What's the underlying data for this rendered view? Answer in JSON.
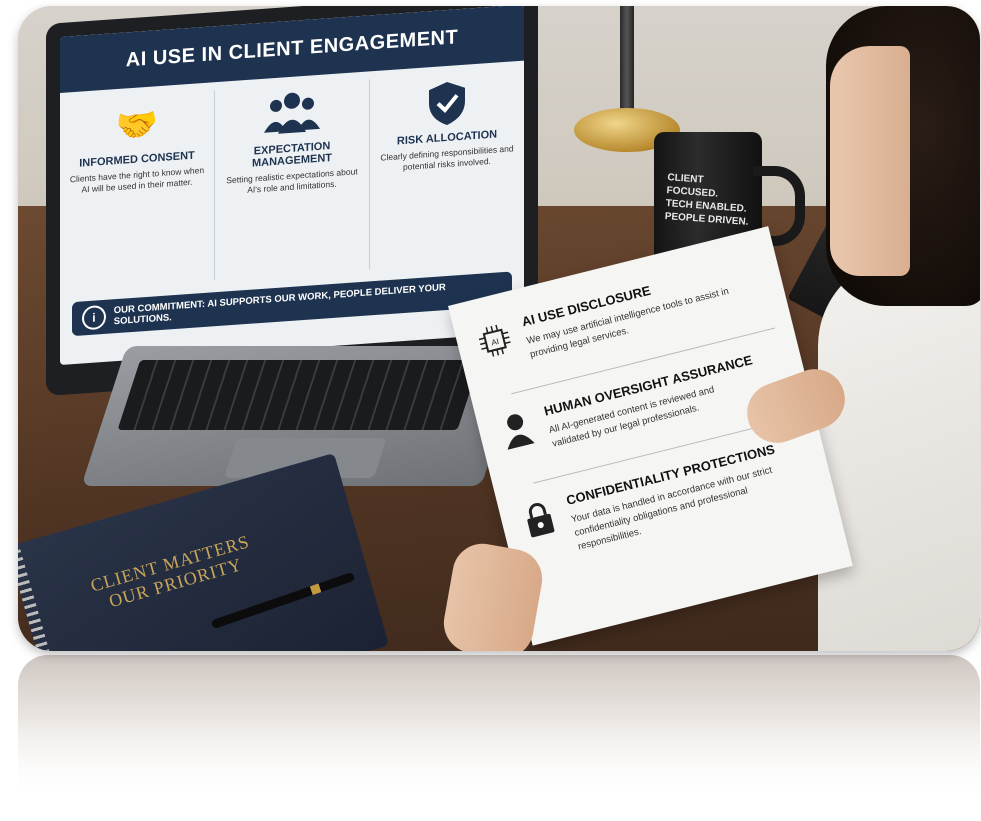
{
  "laptop_screen": {
    "title": "AI USE IN CLIENT ENGAGEMENT",
    "columns": [
      {
        "icon": "handshake-icon",
        "heading": "INFORMED CONSENT",
        "text": "Clients have the right to know when AI will be used in their matter."
      },
      {
        "icon": "people-group-icon",
        "heading": "EXPECTATION MANAGEMENT",
        "text": "Setting realistic expectations about AI's role and limitations."
      },
      {
        "icon": "shield-check-icon",
        "heading": "RISK ALLOCATION",
        "text": "Clearly defining responsibilities and potential risks involved."
      }
    ],
    "commitment": "OUR COMMITMENT: AI SUPPORTS OUR WORK, PEOPLE DELIVER YOUR SOLUTIONS."
  },
  "mug": {
    "line1": "CLIENT",
    "line2": "FOCUSED.",
    "line3": "TECH ENABLED.",
    "line4": "PEOPLE DRIVEN."
  },
  "notebook": {
    "line1": "CLIENT MATTERS",
    "line2": "OUR PRIORITY"
  },
  "paper": {
    "sections": [
      {
        "icon": "ai-chip-icon",
        "title": "AI USE DISCLOSURE",
        "text": "We may use artificial intelligence tools to assist in providing legal services."
      },
      {
        "icon": "person-icon",
        "title": "HUMAN OVERSIGHT ASSURANCE",
        "text": "All AI-generated content is reviewed and validated by our legal professionals."
      },
      {
        "icon": "lock-icon",
        "title": "CONFIDENTIALITY PROTECTIONS",
        "text": "Your data is handled in accordance with our strict confidentiality obligations and professional responsibilities."
      }
    ]
  },
  "colors": {
    "navy": "#1e3350",
    "desk": "#4e3322",
    "gold": "#c9a55a"
  }
}
